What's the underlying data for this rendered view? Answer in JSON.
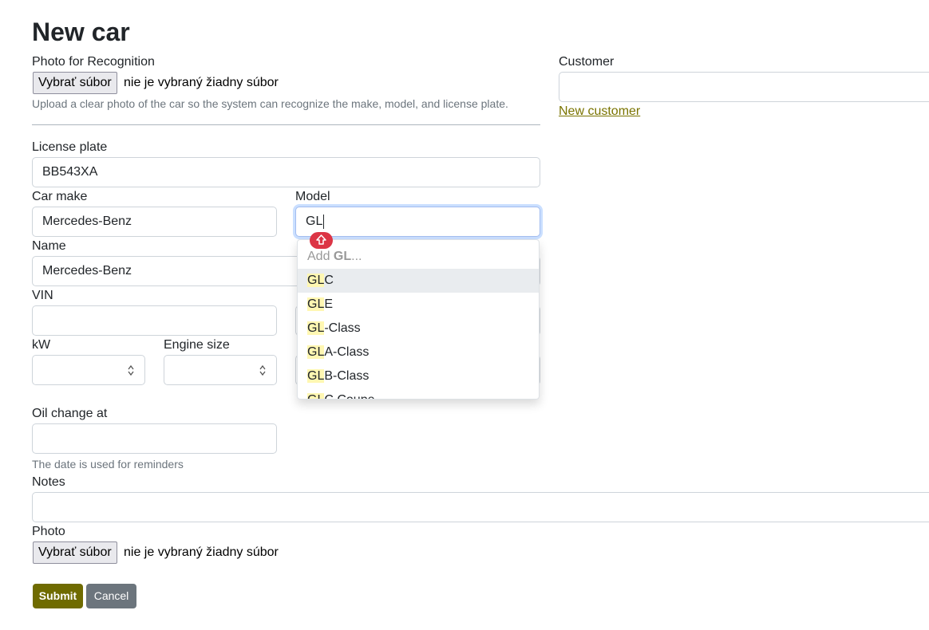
{
  "page": {
    "title": "New car"
  },
  "recognition": {
    "label": "Photo for Recognition",
    "file_button": "Vybrať súbor",
    "file_status": "nie je vybraný žiadny súbor",
    "hint": "Upload a clear photo of the car so the system can recognize the make, model, and license plate."
  },
  "customer": {
    "label": "Customer",
    "value": "",
    "new_link": "New customer"
  },
  "license_plate": {
    "label": "License plate",
    "value": "BB543XA"
  },
  "car_make": {
    "label": "Car make",
    "value": "Mercedes-Benz"
  },
  "model": {
    "label": "Model",
    "value": "GL",
    "dropdown": {
      "add_prefix": "Add ",
      "add_query": "GL",
      "add_suffix": "...",
      "options": [
        {
          "match": "GL",
          "rest": "C"
        },
        {
          "match": "GL",
          "rest": "E"
        },
        {
          "match": "GL",
          "rest": "-Class"
        },
        {
          "match": "GL",
          "rest": "A-Class"
        },
        {
          "match": "GL",
          "rest": "B-Class"
        },
        {
          "match": "GL",
          "rest": "C Coupe"
        }
      ]
    }
  },
  "name": {
    "label": "Name",
    "value": "Mercedes-Benz"
  },
  "vin": {
    "label": "VIN",
    "value": ""
  },
  "kw": {
    "label": "kW",
    "value": ""
  },
  "engine_size": {
    "label": "Engine size",
    "value": ""
  },
  "oil_change": {
    "label": "Oil change at",
    "value": "",
    "hint": "The date is used for reminders"
  },
  "notes": {
    "label": "Notes",
    "value": ""
  },
  "photo": {
    "label": "Photo",
    "file_button": "Vybrať súbor",
    "file_status": "nie je vybraný žiadny súbor"
  },
  "actions": {
    "submit": "Submit",
    "cancel": "Cancel"
  },
  "colors": {
    "accent": "#6f6b00",
    "link": "#7a7400",
    "secondary": "#6c757d",
    "badge": "#dc3545",
    "highlight": "#fff7b2"
  },
  "icons": {
    "badge_icon": "shift-arrow-icon",
    "spinner_icon": "number-spinner-icon"
  }
}
